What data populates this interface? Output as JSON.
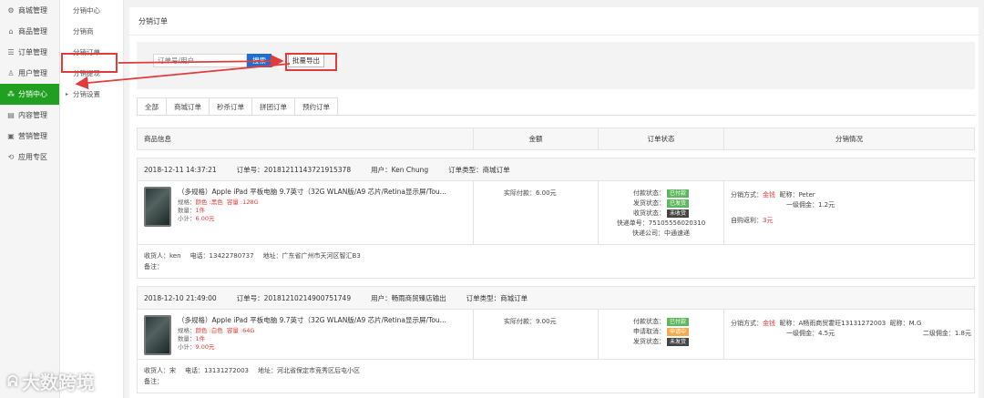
{
  "sidebar_primary": [
    {
      "icon": "gear-icon",
      "glyph": "⚙",
      "label": "商城管理",
      "active": false
    },
    {
      "icon": "shop-icon",
      "glyph": "⌂",
      "label": "商品管理",
      "active": false
    },
    {
      "icon": "order-icon",
      "glyph": "☰",
      "label": "订单管理",
      "active": false
    },
    {
      "icon": "user-icon",
      "glyph": "♙",
      "label": "用户管理",
      "active": false
    },
    {
      "icon": "distribution-icon",
      "glyph": "⁂",
      "label": "分销中心",
      "active": true
    },
    {
      "icon": "content-icon",
      "glyph": "▤",
      "label": "内容管理",
      "active": false
    },
    {
      "icon": "marketing-icon",
      "glyph": "▣",
      "label": "营销管理",
      "active": false
    },
    {
      "icon": "apps-icon",
      "glyph": "⟲",
      "label": "应用专区",
      "active": false
    }
  ],
  "sidebar_secondary": [
    {
      "label": "分销中心"
    },
    {
      "label": "分销商"
    },
    {
      "label": "分销订单"
    },
    {
      "label": "分销提现"
    },
    {
      "label": "分销设置"
    }
  ],
  "page_title": "分销订单",
  "filter": {
    "search_placeholder": "订单号/用户",
    "search_button": "搜索",
    "export_button": "批量导出"
  },
  "tabs": [
    "全部",
    "商城订单",
    "秒杀订单",
    "拼团订单",
    "预约订单"
  ],
  "table_headers": [
    "商品信息",
    "金额",
    "订单状态",
    "分销情况"
  ],
  "orders": [
    {
      "time": "2018-12-11 14:37:21",
      "order_no": "订单号：20181211143721915378",
      "user": "用户：Ken Chung",
      "order_type": "订单类型：商城订单",
      "product_name": "（多规格）Apple iPad 平板电脑 9.7英寸（32G WLAN版/A9 芯片/Retina显示屏/Tou...",
      "spec_label": "规格：",
      "spec_color": "颜色 :黑色",
      "spec_capacity": "容量 :128G",
      "qty_label": "数量：",
      "qty": "1件",
      "subtotal_label": "小计：",
      "subtotal": "6.00元",
      "paid": "实际付款：6.00元",
      "status": [
        {
          "label": "付款状态：",
          "badge": "已付款",
          "tone": "green"
        },
        {
          "label": "发货状态：",
          "badge": "已发货",
          "tone": "green"
        },
        {
          "label": "收货状态：",
          "badge": "未收货",
          "tone": "dark"
        }
      ],
      "tracking_no": "快递单号：75105556020310",
      "courier": "快递公司：中通速递",
      "dist_method_label": "分销方式：",
      "dist_method": "金钱",
      "dist_nick": "昵称：Peter",
      "dist_commission": "一级佣金：1.2元",
      "dist_nick2": "",
      "dist_commission2": "",
      "self_rebate_label": "自购返利：",
      "self_rebate": "3元",
      "receiver": "收货人：ken",
      "phone": "电话：13422780737",
      "address": "地址：广东省广州市天河区智汇B3",
      "note": "备注："
    },
    {
      "time": "2018-12-10 21:49:00",
      "order_no": "订单号：20181210214900751749",
      "user": "用户：畅雨商贸臻店输出",
      "order_type": "订单类型：商城订单",
      "product_name": "（多规格）Apple iPad 平板电脑 9.7英寸（32G WLAN版/A9 芯片/Retina显示屏/Tou...",
      "spec_label": "规格：",
      "spec_color": "颜色 :白色",
      "spec_capacity": "容量 :64G",
      "qty_label": "数量：",
      "qty": "1件",
      "subtotal_label": "小计：",
      "subtotal": "9.00元",
      "paid": "实际付款：9.00元",
      "status": [
        {
          "label": "付款状态：",
          "badge": "已付款",
          "tone": "green"
        },
        {
          "label": "申请取消：",
          "badge": "申请中",
          "tone": "orange"
        },
        {
          "label": "发货状态：",
          "badge": "未发货",
          "tone": "dark"
        }
      ],
      "tracking_no": "",
      "courier": "",
      "dist_method_label": "分销方式：",
      "dist_method": "金钱",
      "dist_nick": "昵称：A畅雨商贸霍旺13131272003",
      "dist_commission": "一级佣金：4.5元",
      "dist_nick2": "昵称：M.G",
      "dist_commission2": "二级佣金：1.8元",
      "self_rebate_label": "",
      "self_rebate": "",
      "receiver": "收货人：宋",
      "phone": "电话：13131272003",
      "address": "地址：河北省保定市竞秀区后屯小区",
      "note": "备注："
    }
  ],
  "watermark": "大数跨境",
  "colors": {
    "active_nav": "#1fa01f",
    "primary_button": "#1d6fd0",
    "highlight_annotation": "#e23b3b",
    "price_red": "#e53935"
  }
}
